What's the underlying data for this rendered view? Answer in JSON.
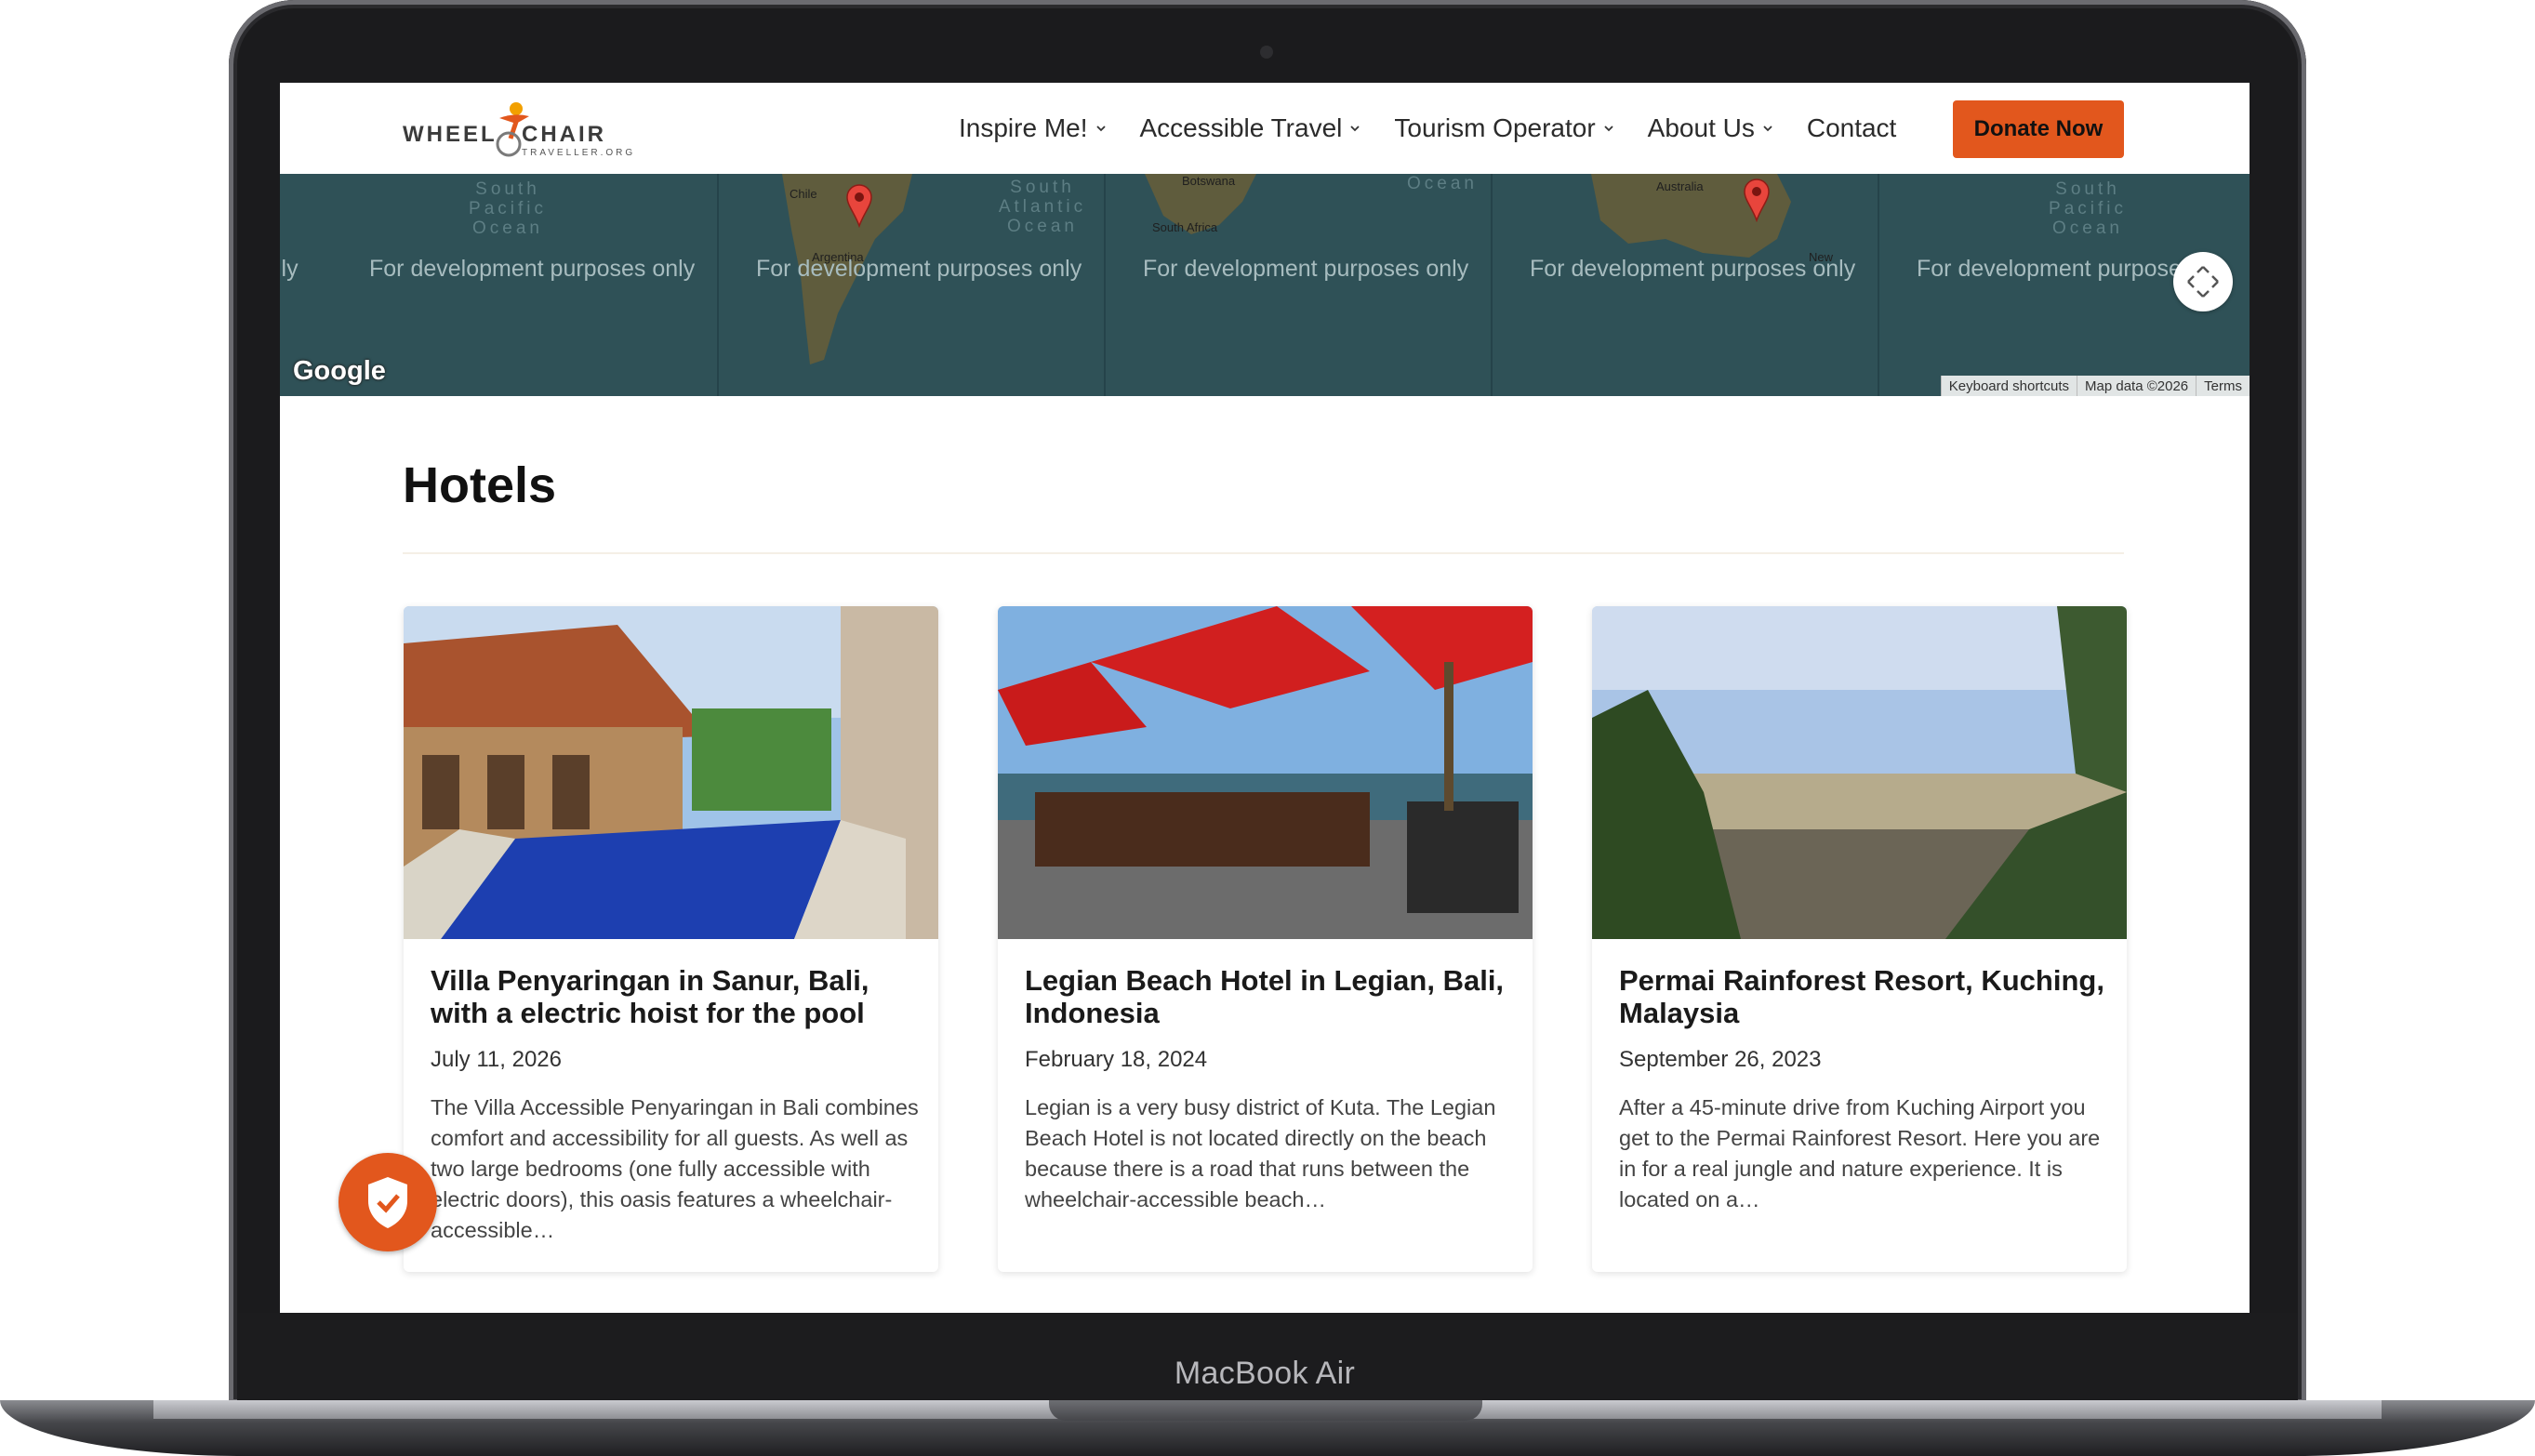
{
  "device": {
    "brand_label": "MacBook Air"
  },
  "header": {
    "logo": {
      "word1": "WHEEL",
      "word2": "CHAIR",
      "sub": "TRAVELLER.ORG"
    },
    "nav": [
      {
        "label": "Inspire Me!",
        "has_dropdown": true
      },
      {
        "label": "Accessible Travel",
        "has_dropdown": true
      },
      {
        "label": "Tourism Operator",
        "has_dropdown": true
      },
      {
        "label": "About Us",
        "has_dropdown": true
      },
      {
        "label": "Contact",
        "has_dropdown": false
      }
    ],
    "donate_label": "Donate Now",
    "accent_color": "#e2571d"
  },
  "map": {
    "watermark": "For development purposes only",
    "watermark_partial_left": "ily",
    "watermark_partial_right": "For development purpose",
    "oceans": [
      "South Pacific Ocean",
      "South Atlantic Ocean",
      "Ocean",
      "South Pacific Ocean"
    ],
    "countries": [
      "Chile",
      "Argentina",
      "Botswana",
      "South Africa",
      "Australia",
      "New"
    ],
    "google_logo": "Google",
    "attribution": [
      "Keyboard shortcuts",
      "Map data ©2026",
      "Terms"
    ],
    "fullscreen_icon": "fullscreen-icon"
  },
  "hotels": {
    "title": "Hotels",
    "cards": [
      {
        "title": "Villa Penyaringan in Sanur, Bali, with a electric hoist for the pool",
        "date": "July 11, 2026",
        "excerpt": "The Villa Accessible Penyaringan in Bali combines comfort and accessibility for all guests. As well as two large bedrooms (one fully accessible with electric doors), this oasis features a wheelchair-accessible…"
      },
      {
        "title": "Legian Beach Hotel in Legian, Bali, Indonesia",
        "date": "February 18, 2024",
        "excerpt": "Legian is a very busy district of Kuta. The Legian Beach Hotel is not located directly on the beach because there is a road that runs between the wheelchair-accessible beach…"
      },
      {
        "title": "Permai Rainforest Resort, Kuching, Malaysia",
        "date": "September 26, 2023",
        "excerpt": "After a 45-minute drive from Kuching Airport you get to the Permai Rainforest Resort. Here you are in for a real jungle and nature experience. It is located on a…"
      }
    ]
  },
  "privacy_badge_icon": "shield-check-icon"
}
